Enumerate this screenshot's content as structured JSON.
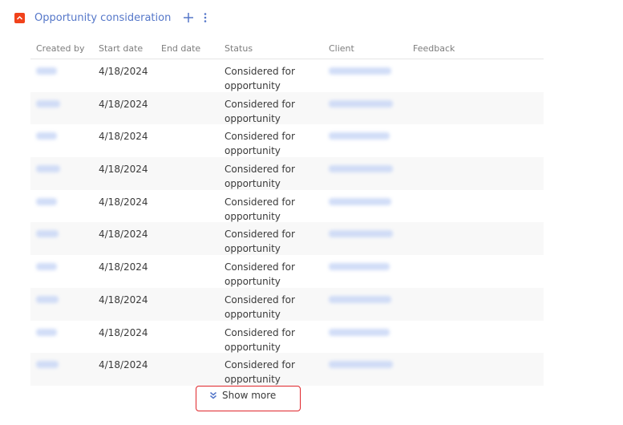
{
  "detail": {
    "title": "Opportunity consideration",
    "accent_color": "#f1421b",
    "link_color": "#5577c9"
  },
  "icons": {
    "collapse": "chevron-up-icon",
    "add": "plus-icon",
    "more": "vertical-dots-icon",
    "show_more": "double-chevron-down-icon"
  },
  "table": {
    "columns": [
      "Created by",
      "Start date",
      "End date",
      "Status",
      "Client",
      "Feedback"
    ],
    "rows": [
      {
        "start_date": "4/18/2024",
        "end_date": "",
        "status": "Considered for opportunity",
        "feedback": ""
      },
      {
        "start_date": "4/18/2024",
        "end_date": "",
        "status": "Considered for opportunity",
        "feedback": ""
      },
      {
        "start_date": "4/18/2024",
        "end_date": "",
        "status": "Considered for opportunity",
        "feedback": ""
      },
      {
        "start_date": "4/18/2024",
        "end_date": "",
        "status": "Considered for opportunity",
        "feedback": ""
      },
      {
        "start_date": "4/18/2024",
        "end_date": "",
        "status": "Considered for opportunity",
        "feedback": ""
      },
      {
        "start_date": "4/18/2024",
        "end_date": "",
        "status": "Considered for opportunity",
        "feedback": ""
      },
      {
        "start_date": "4/18/2024",
        "end_date": "",
        "status": "Considered for opportunity",
        "feedback": ""
      },
      {
        "start_date": "4/18/2024",
        "end_date": "",
        "status": "Considered for opportunity",
        "feedback": ""
      },
      {
        "start_date": "4/18/2024",
        "end_date": "",
        "status": "Considered for opportunity",
        "feedback": ""
      },
      {
        "start_date": "4/18/2024",
        "end_date": "",
        "status": "Considered for opportunity",
        "feedback": ""
      }
    ]
  },
  "show_more_label": "Show more",
  "highlight_color": "#e0262b"
}
